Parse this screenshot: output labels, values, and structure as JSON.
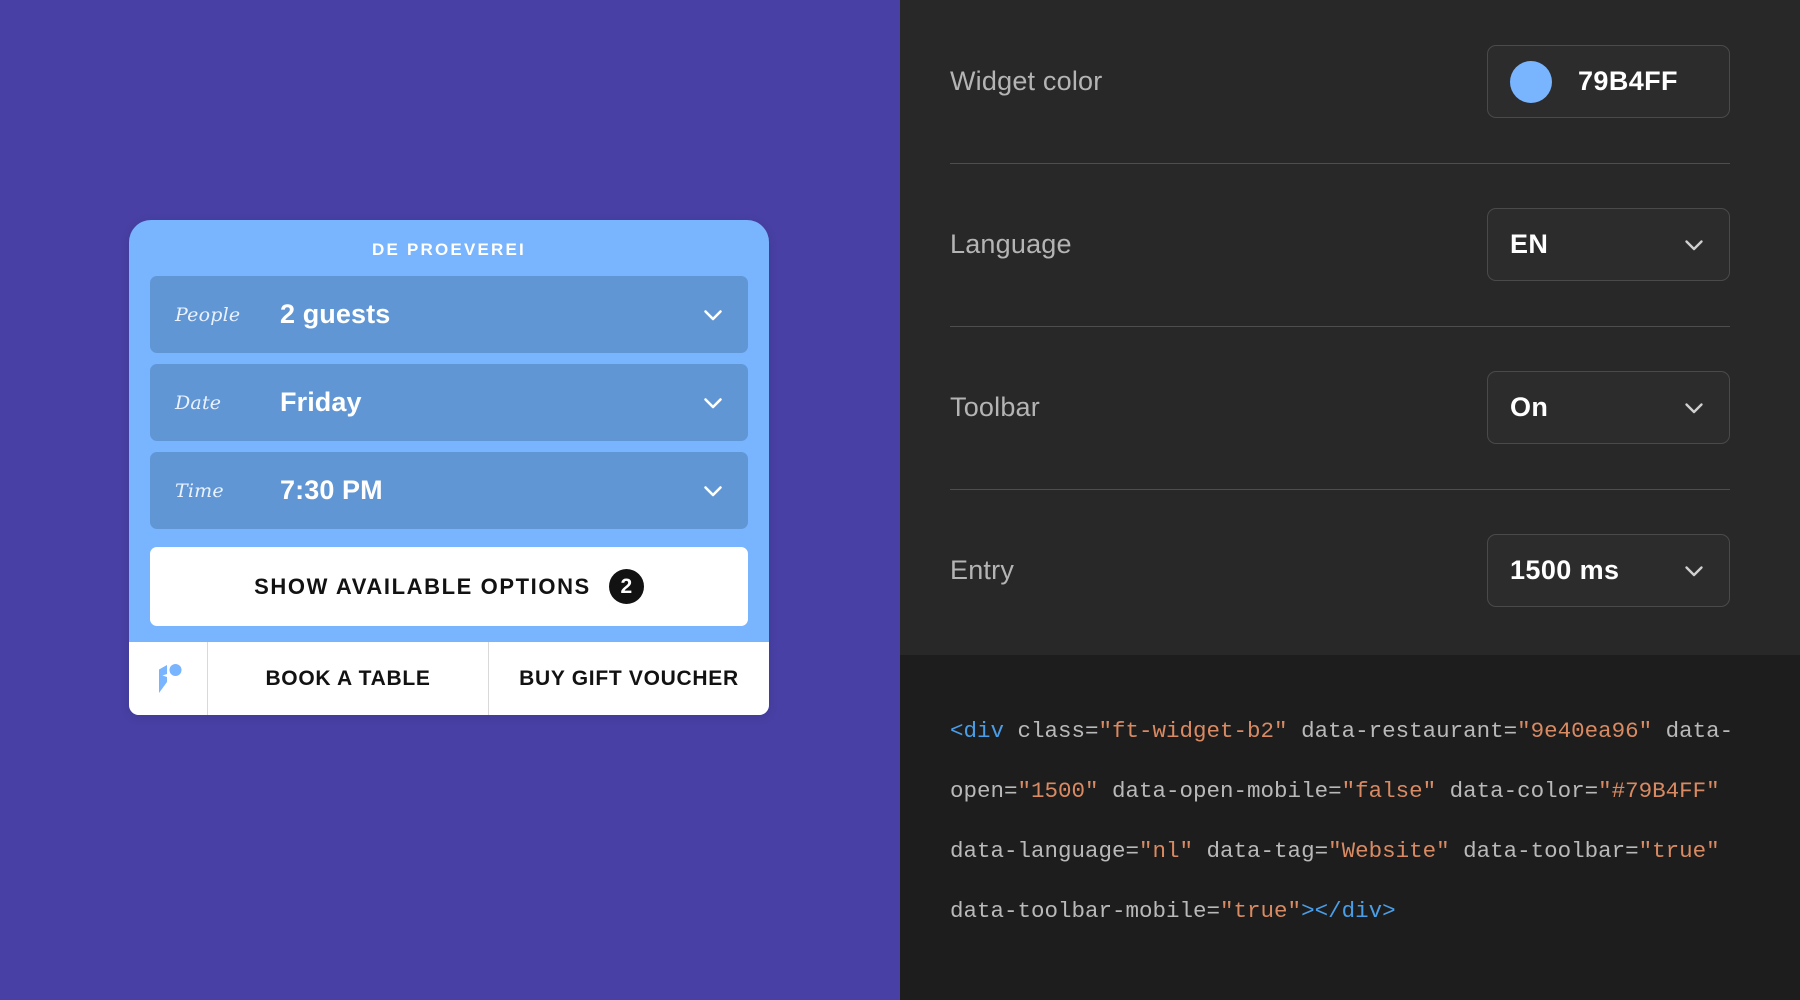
{
  "theme": {
    "preview_background": "#4840A4",
    "panel_background": "#282828",
    "code_background": "#1D1D1D",
    "widget_color": "#79B4FF",
    "widget_field_color": "#6096D4",
    "accent_text": "#FFFFFF",
    "code_tag_color": "#4A9EE8",
    "code_string_color": "#D98A62",
    "code_plain_color": "#B9B9B9"
  },
  "widget": {
    "title": "DE PROEVEREI",
    "fields": [
      {
        "label": "People",
        "value": "2 guests",
        "icon": "chevron-down-icon"
      },
      {
        "label": "Date",
        "value": "Friday",
        "icon": "chevron-down-icon"
      },
      {
        "label": "Time",
        "value": "7:30 PM",
        "icon": "chevron-down-icon"
      }
    ],
    "cta": {
      "label": "SHOW AVAILABLE OPTIONS",
      "badge": "2"
    },
    "toolbar": {
      "logo_icon": "formitable-logo-icon",
      "buttons": [
        {
          "label": "BOOK A TABLE"
        },
        {
          "label": "BUY GIFT VOUCHER"
        }
      ]
    }
  },
  "settings": {
    "rows": [
      {
        "label": "Widget color",
        "type": "color",
        "value": "79B4FF",
        "swatch": "#79B4FF",
        "icon": "color-swatch-icon"
      },
      {
        "label": "Language",
        "type": "select",
        "value": "EN",
        "icon": "chevron-down-icon"
      },
      {
        "label": "Toolbar",
        "type": "select",
        "value": "On",
        "icon": "chevron-down-icon"
      },
      {
        "label": "Entry",
        "type": "select",
        "value": "1500 ms",
        "icon": "chevron-down-icon"
      }
    ]
  },
  "code_snippet": {
    "full_text": "<div class=\"ft-widget-b2\" data-restaurant=\"9e40ea96\" data-open=\"1500\" data-open-mobile=\"false\" data-color=\"#79B4FF\" data-language=\"nl\" data-tag=\"Website\" data-toolbar=\"true\" data-toolbar-mobile=\"true\"></div>",
    "tokens": [
      {
        "t": "tag",
        "v": "<div"
      },
      {
        "t": "plain",
        "v": " class="
      },
      {
        "t": "str",
        "v": "\"ft-widget-b2\""
      },
      {
        "t": "plain",
        "v": " data-restaurant="
      },
      {
        "t": "str",
        "v": "\"9e40ea96\""
      },
      {
        "t": "plain",
        "v": " data-open="
      },
      {
        "t": "str",
        "v": "\"1500\""
      },
      {
        "t": "plain",
        "v": " data-open-mobile="
      },
      {
        "t": "str",
        "v": "\"false\""
      },
      {
        "t": "plain",
        "v": " data-color="
      },
      {
        "t": "str",
        "v": "\"#79B4FF\""
      },
      {
        "t": "plain",
        "v": " data-language="
      },
      {
        "t": "str",
        "v": "\"nl\""
      },
      {
        "t": "plain",
        "v": " data-tag="
      },
      {
        "t": "str",
        "v": "\"Website\""
      },
      {
        "t": "plain",
        "v": " data-toolbar="
      },
      {
        "t": "str",
        "v": "\"true\""
      },
      {
        "t": "plain",
        "v": " data-toolbar-mobile="
      },
      {
        "t": "str",
        "v": "\"true\""
      },
      {
        "t": "tag",
        "v": "></div>"
      }
    ]
  }
}
